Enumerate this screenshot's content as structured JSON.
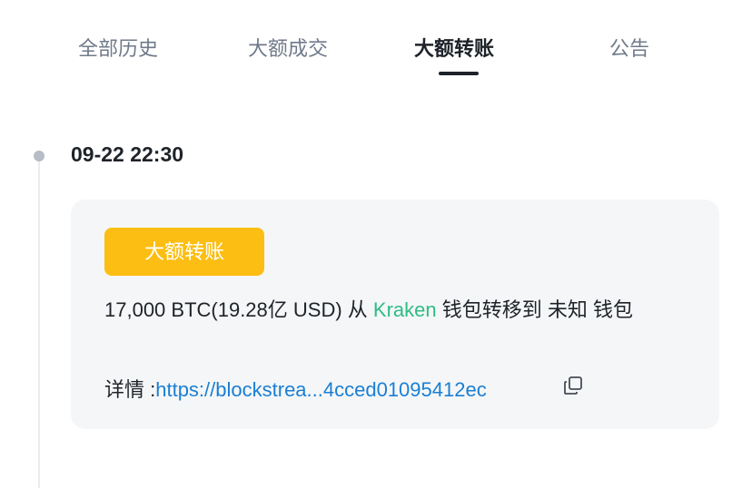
{
  "tabs": [
    {
      "label": "全部历史",
      "active": false
    },
    {
      "label": "大额成交",
      "active": false
    },
    {
      "label": "大额转账",
      "active": true
    },
    {
      "label": "公告",
      "active": false
    }
  ],
  "timeline": {
    "timestamp": "09-22 22:30"
  },
  "card": {
    "badge_label": "大额转账",
    "summary": {
      "amount": "17,000 BTC(19.28亿 USD)",
      "from_word": " 从 ",
      "source_exchange": "Kraken",
      "rest": " 钱包转移到 未知 钱包"
    },
    "details": {
      "label": "详情 :",
      "link_text": "https://blockstrea...4cced01095412ec"
    }
  },
  "colors": {
    "badge": "#fcbe12",
    "exchange_text": "#2ebd85",
    "link": "#1a7fd4",
    "active_tab_indicator": "#1e2329"
  },
  "icons": {
    "copy": "copy-icon"
  }
}
